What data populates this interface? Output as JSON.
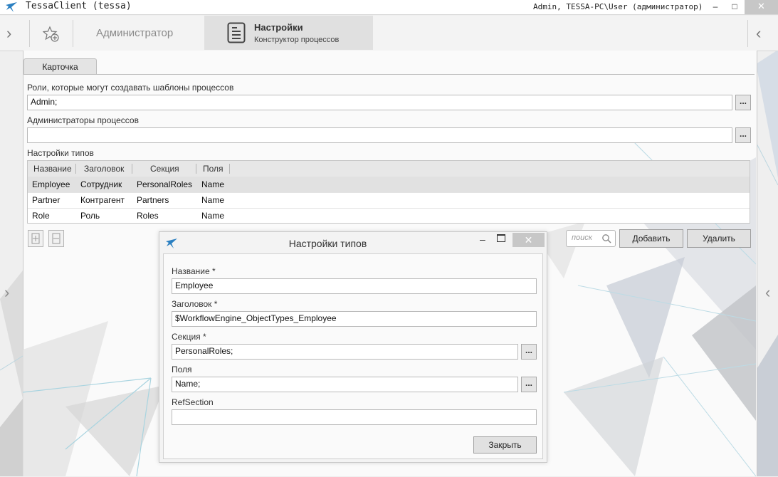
{
  "window": {
    "title": "TessaClient (tessa)",
    "user": "Admin, TESSA-PC\\User (администратор)",
    "min_glyph": "–",
    "max_glyph": "□",
    "close_glyph": "✕"
  },
  "topnav": {
    "left_arrow": "›",
    "right_arrow": "‹",
    "tab_admin": "Администратор",
    "tab_settings_title": "Настройки",
    "tab_settings_subtitle": "Конструктор процессов"
  },
  "card": {
    "tab_label": "Карточка",
    "roles_label": "Роли, которые могут создавать шаблоны процессов",
    "roles_value": "Admin;",
    "admins_label": "Администраторы процессов",
    "admins_value": "",
    "types_label": "Настройки типов",
    "ellipsis": "...",
    "table": {
      "columns": [
        "Название",
        "Заголовок",
        "Секция",
        "Поля"
      ],
      "rows": [
        [
          "Employee",
          "Сотрудник",
          "PersonalRoles",
          "Name"
        ],
        [
          "Partner",
          "Контрагент",
          "Partners",
          "Name"
        ],
        [
          "Role",
          "Роль",
          "Roles",
          "Name"
        ]
      ],
      "selected_row": 0
    },
    "search_placeholder": "поиск",
    "add_button": "Добавить",
    "delete_button": "Удалить",
    "side_arrow_left": "›",
    "side_arrow_right": "‹"
  },
  "dialog": {
    "title": "Настройки типов",
    "min_glyph": "–",
    "close_glyph": "✕",
    "name_label": "Название  *",
    "name_value": "Employee",
    "caption_label": "Заголовок  *",
    "caption_value": "$WorkflowEngine_ObjectTypes_Employee",
    "section_label": "Секция  *",
    "section_value": "PersonalRoles;",
    "fields_label": "Поля",
    "fields_value": "Name;",
    "refsection_label": "RefSection",
    "refsection_value": "",
    "close_button": "Закрыть",
    "ellipsis": "..."
  },
  "colors": {
    "accent_blue": "#2a7fc1",
    "selected_row": "#e1e1e1",
    "close_button": "#c7c7c7"
  }
}
